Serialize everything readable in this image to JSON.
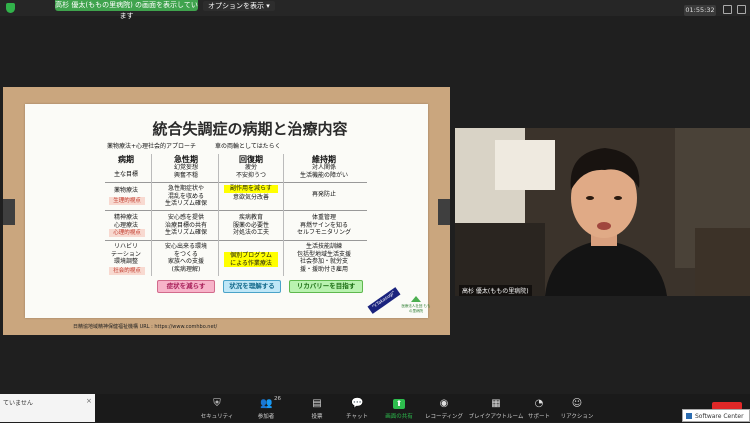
{
  "top": {
    "share_banner": "高杉 優太(ももの里病院) の画面を表示しています",
    "view_options": "オプションを表示 ▾",
    "timer": "01:55:32"
  },
  "slide": {
    "title": "統合失調症の病期と治療内容",
    "approach_left": "薬物療法+心理社会的アプローチ",
    "approach_right": "車の両輪としてはたらく",
    "headers": [
      "病期",
      "急性期",
      "回復期",
      "維持期"
    ],
    "row_goal": {
      "label": "主な目標",
      "acute": "幻覚妄想\n興奮不穏",
      "recovery": "疲労\n不安抑うつ",
      "maintenance": "対人関係\n生活機能の障がい"
    },
    "row_drug": {
      "label": "薬物療法",
      "tag": "生理的視点",
      "acute": "急性期症状や\n混乱を収める\n生活リズム確保",
      "recovery_hl": "副作用を減らす",
      "recovery": "意欲気分改善",
      "maintenance": "再発防止"
    },
    "row_psych": {
      "label": "精神療法\n心理療法",
      "tag": "心理的視点",
      "acute": "安心感を提供\n治療目標の共有\n生活リズム確保",
      "recovery": "疾病教育\n服薬の必要性\n対処法の工夫",
      "maintenance": "体重管理\n再燃サインを知る\nセルフモニタリング"
    },
    "row_rehab": {
      "label": "リハビリ\nテーション\n環境調整",
      "tag": "社会的視点",
      "acute": "安心出来る環境\nをつくる\n家族への支援\n(疾病理解)",
      "recovery_hl": "個別プログラム\nによる作業療法",
      "maintenance": "生活技能訓練\n包括型地域生活支援\n社会参加・就労支\n援・援助付き雇用"
    },
    "pills": [
      "症状を減らす",
      "状況を理解する",
      "リカバリーを目指す"
    ],
    "pill_colors": [
      "#f7b3c9",
      "#bfe7f7",
      "#b9f2b0"
    ],
    "footer": "日精協地域精神保健福祉機構 URL : https://www.comhbo.net/",
    "stamp": "\"Y.Takasugi\"",
    "logo_text": "医療法人社団 ももの里病院"
  },
  "camera": {
    "name": "高杉 優太(ももの里病院)"
  },
  "notify": {
    "text": "ていません"
  },
  "toolbar": [
    {
      "icon": "security-icon",
      "glyph": "⛨",
      "label": "セキュリティ"
    },
    {
      "icon": "participants-icon",
      "glyph": "👥",
      "label": "参加者",
      "badge": "26"
    },
    {
      "icon": "polls-icon",
      "glyph": "▤",
      "label": "投票"
    },
    {
      "icon": "chat-icon",
      "glyph": "💬",
      "label": "チャット"
    },
    {
      "icon": "share-screen-icon",
      "glyph": "⬆",
      "label": "画面の共有"
    },
    {
      "icon": "record-icon",
      "glyph": "◉",
      "label": "レコーディング"
    },
    {
      "icon": "breakout-icon",
      "glyph": "▦",
      "label": "ブレイクアウトルーム"
    },
    {
      "icon": "support-icon",
      "glyph": "◔",
      "label": "サポート"
    },
    {
      "icon": "reactions-icon",
      "glyph": "☺",
      "label": "リアクション"
    }
  ],
  "software_center": "Software Center",
  "colors": {
    "accent_green": "#3fa34d",
    "share_green": "#2dbd4d",
    "highlight": "#ffff00",
    "leave_red": "#e02828"
  }
}
